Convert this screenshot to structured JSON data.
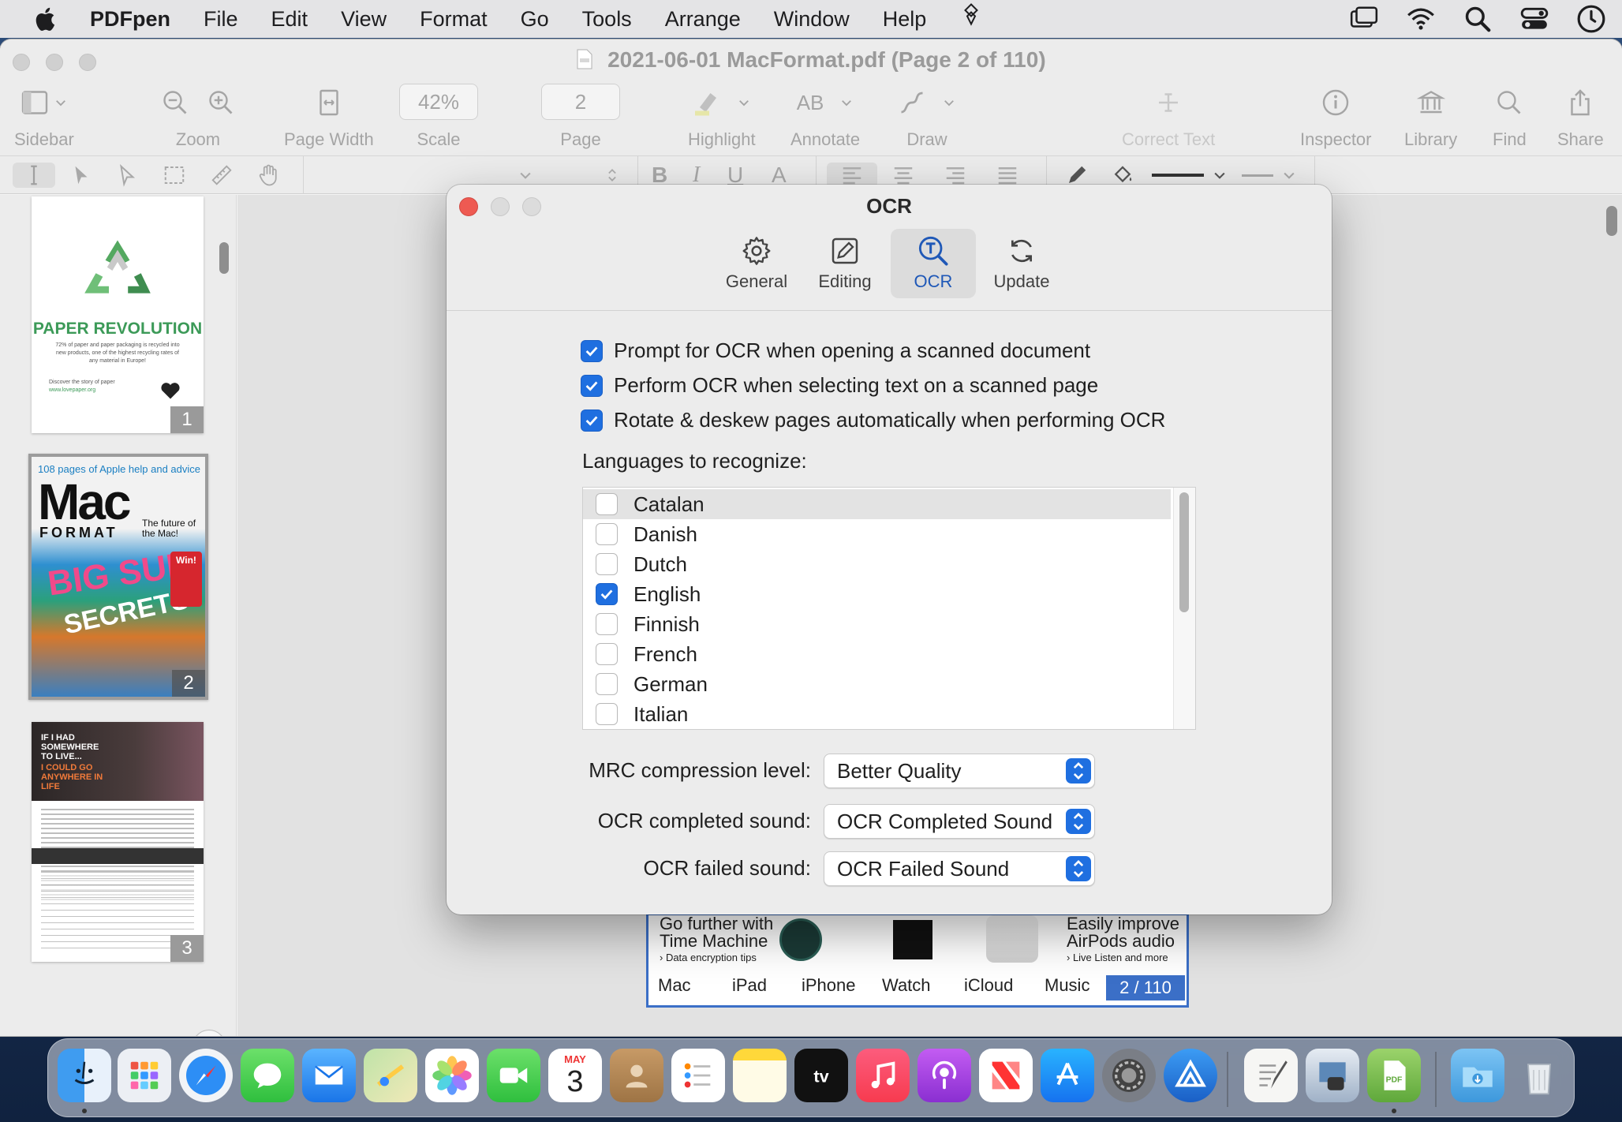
{
  "menubar": {
    "app_name": "PDFpen",
    "items": [
      "File",
      "Edit",
      "View",
      "Format",
      "Go",
      "Tools",
      "Arrange",
      "Window",
      "Help"
    ],
    "icons": [
      "script-icon",
      "screen-mirroring-icon",
      "wifi-icon",
      "spotlight-search-icon",
      "control-center-icon",
      "clock-icon"
    ]
  },
  "window": {
    "title": "2021-06-01 MacFormat.pdf (Page 2 of 110)",
    "toolbar": {
      "sidebar": "Sidebar",
      "zoom": "Zoom",
      "page_width": "Page Width",
      "scale": "Scale",
      "scale_value": "42%",
      "page": "Page",
      "page_value": "2",
      "highlight": "Highlight",
      "annotate": "Annotate",
      "annotate_glyph": "AB",
      "draw": "Draw",
      "correct_text": "Correct Text",
      "inspector": "Inspector",
      "library": "Library",
      "find": "Find",
      "share": "Share"
    },
    "formatbar": {
      "bold": "B",
      "italic": "I",
      "underline": "U",
      "font_color": "A"
    }
  },
  "sidebar": {
    "thumbnails": [
      {
        "page": "1",
        "headline": "PAPER REVOLUTION",
        "body": "72% of paper and paper packaging is recycled into new products, one of the highest recycling rates of any material in Europe!",
        "footer": "Discover the story of paper",
        "url": "www.lovepaper.org"
      },
      {
        "page": "2",
        "banner": "108 pages of Apple help and advice",
        "mast1": "Mac",
        "mast2": "FORMAT",
        "cover1": "BIG SUR",
        "cover2": "SECRETS",
        "cover3": "The future of the Mac!",
        "cover4": "Win!"
      },
      {
        "page": "3",
        "headline": "IF I HAD SOMEWHERE TO LIVE...",
        "sub": "I COULD GO ANYWHERE IN LIFE"
      }
    ]
  },
  "page_fragment": {
    "left_block": "Go further with Time Machine",
    "left_sub": "› Data encryption tips",
    "right_block": "Easily improve AirPods audio",
    "right_sub": "› Live Listen and more",
    "bottom_labels": [
      "Mac",
      "iPad",
      "iPhone",
      "Watch",
      "iCloud",
      "Music"
    ],
    "page_counter": "2 / 110"
  },
  "dialog": {
    "title": "OCR",
    "tabs": [
      {
        "label": "General",
        "icon": "gear-icon"
      },
      {
        "label": "Editing",
        "icon": "edit-icon"
      },
      {
        "label": "OCR",
        "icon": "ocr-icon"
      },
      {
        "label": "Update",
        "icon": "update-icon"
      }
    ],
    "active_tab": "OCR",
    "options": [
      {
        "label": "Prompt for OCR when opening a scanned document",
        "checked": true
      },
      {
        "label": "Perform OCR when selecting text on a scanned page",
        "checked": true
      },
      {
        "label": "Rotate & deskew pages automatically when performing OCR",
        "checked": true
      }
    ],
    "languages_label": "Languages to recognize:",
    "languages": [
      {
        "name": "Catalan",
        "checked": false
      },
      {
        "name": "Danish",
        "checked": false
      },
      {
        "name": "Dutch",
        "checked": false
      },
      {
        "name": "English",
        "checked": true
      },
      {
        "name": "Finnish",
        "checked": false
      },
      {
        "name": "French",
        "checked": false
      },
      {
        "name": "German",
        "checked": false
      },
      {
        "name": "Italian",
        "checked": false
      }
    ],
    "mrc_label": "MRC compression level:",
    "mrc_value": "Better Quality",
    "completed_label": "OCR completed sound:",
    "completed_value": "OCR Completed Sound",
    "failed_label": "OCR failed sound:",
    "failed_value": "OCR Failed Sound"
  },
  "dock": {
    "calendar_month": "MAY",
    "calendar_day": "3",
    "apps": [
      "Finder",
      "Launchpad",
      "Safari",
      "Messages",
      "Mail",
      "Maps",
      "Photos",
      "FaceTime",
      "Calendar",
      "Contacts",
      "Reminders",
      "Notes",
      "TV",
      "Music",
      "Podcasts",
      "News",
      "App Store",
      "System Preferences",
      "Affinity",
      "TextEdit",
      "Preview",
      "PDFpen",
      "Downloads",
      "Trash"
    ]
  },
  "colors": {
    "accent": "#1f6fe0",
    "close_button": "#ee5a52",
    "tab_active": "#1f58b7"
  }
}
